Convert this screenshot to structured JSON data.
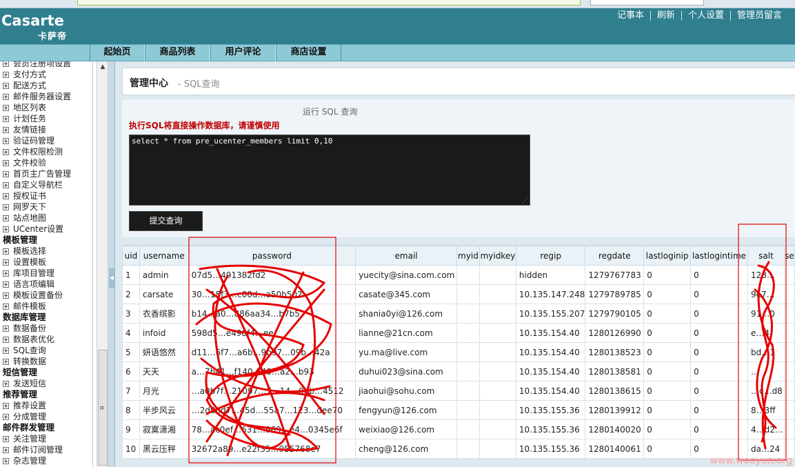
{
  "header": {
    "logo_main": "Casarte",
    "logo_sub": "卡萨帝",
    "links": [
      "记事本",
      "刷新",
      "个人设置",
      "管理员留言"
    ]
  },
  "nav": {
    "tabs": [
      "起始页",
      "商品列表",
      "用户评论",
      "商店设置"
    ]
  },
  "sidebar": {
    "items": [
      {
        "type": "item",
        "label": "会员注册项设置"
      },
      {
        "type": "item",
        "label": "支付方式"
      },
      {
        "type": "item",
        "label": "配送方式"
      },
      {
        "type": "item",
        "label": "邮件服务器设置"
      },
      {
        "type": "item",
        "label": "地区列表"
      },
      {
        "type": "item",
        "label": "计划任务"
      },
      {
        "type": "item",
        "label": "友情链接"
      },
      {
        "type": "item",
        "label": "验证码管理"
      },
      {
        "type": "item",
        "label": "文件权限检测"
      },
      {
        "type": "item",
        "label": "文件校验"
      },
      {
        "type": "item",
        "label": "首页主广告管理"
      },
      {
        "type": "item",
        "label": "自定义导航栏"
      },
      {
        "type": "item",
        "label": "授权证书"
      },
      {
        "type": "item",
        "label": "网罗天下"
      },
      {
        "type": "item",
        "label": "站点地图"
      },
      {
        "type": "item",
        "label": "UCenter设置"
      },
      {
        "type": "head",
        "label": "模板管理"
      },
      {
        "type": "item",
        "label": "模板选择"
      },
      {
        "type": "item",
        "label": "设置模板"
      },
      {
        "type": "item",
        "label": "库项目管理"
      },
      {
        "type": "item",
        "label": "语言项编辑"
      },
      {
        "type": "item",
        "label": "模板设置备份"
      },
      {
        "type": "item",
        "label": "邮件模板"
      },
      {
        "type": "head",
        "label": "数据库管理"
      },
      {
        "type": "item",
        "label": "数据备份"
      },
      {
        "type": "item",
        "label": "数据表优化"
      },
      {
        "type": "item",
        "label": "SQL查询"
      },
      {
        "type": "item",
        "label": "转换数据"
      },
      {
        "type": "head",
        "label": "短信管理"
      },
      {
        "type": "item",
        "label": "发送短信"
      },
      {
        "type": "head",
        "label": "推荐管理"
      },
      {
        "type": "item",
        "label": "推荐设置"
      },
      {
        "type": "item",
        "label": "分成管理"
      },
      {
        "type": "head",
        "label": "邮件群发管理"
      },
      {
        "type": "item",
        "label": "关注管理"
      },
      {
        "type": "item",
        "label": "邮件订阅管理"
      },
      {
        "type": "item",
        "label": "杂志管理"
      }
    ]
  },
  "main": {
    "title": "管理中心",
    "subtitle": "- SQL查询",
    "panel_title": "运行 SQL 查询",
    "warning": "执行SQL将直接操作数据库，请谨慎使用",
    "sql": "select * from pre_ucenter_members limit 0,10",
    "submit": "提交查询"
  },
  "table": {
    "columns": [
      "uid",
      "username",
      "password",
      "email",
      "myid",
      "myidkey",
      "regip",
      "regdate",
      "lastloginip",
      "lastlogintime",
      "salt",
      "se"
    ],
    "rows": [
      [
        "1",
        "admin",
        "07d5…491382fd2",
        "yuecity@sina.com.com",
        "",
        "",
        "hidden",
        "1279767783",
        "0",
        "0",
        "128…",
        ""
      ],
      [
        "2",
        "carsate",
        "30…18f3…c00d…a50b502",
        "casate@345.com",
        "",
        "",
        "10.135.147.248",
        "1279789785",
        "0",
        "0",
        "9e7…",
        ""
      ],
      [
        "3",
        "衣香缤影",
        "b14…a0…886aa34…b7b5",
        "shania0yi@126.com",
        "",
        "",
        "10.135.155.207",
        "1279790105",
        "0",
        "0",
        "91…0",
        ""
      ],
      [
        "4",
        "infoid",
        "598d5…e498f4…ee",
        "lianne@21cn.com",
        "",
        "",
        "10.135.154.40",
        "1280126990",
        "0",
        "0",
        "e…4",
        ""
      ],
      [
        "5",
        "妍语悠然",
        "d11…6f7…a6b…9b97…09b…42a",
        "yu.ma@live.com",
        "",
        "",
        "10.135.154.40",
        "1280138523",
        "0",
        "0",
        "bd…1",
        ""
      ],
      [
        "6",
        "天天",
        "a…7b41…f140…40…a2…b93",
        "duhui023@sina.com",
        "",
        "",
        "10.135.154.40",
        "1280138581",
        "0",
        "0",
        "…",
        ""
      ],
      [
        "7",
        "月光",
        "…a0b7f…21097…7…14…0db…4512",
        "jiaohui@sohu.com",
        "",
        "",
        "10.135.154.40",
        "1280138615",
        "0",
        "0",
        "…c…d8",
        ""
      ],
      [
        "8",
        "半步风云",
        "…2d0bd7…45d…55a7…123…dee70",
        "fengyun@126.com",
        "",
        "",
        "10.135.155.36",
        "1280139912",
        "0",
        "0",
        "8…3ff",
        ""
      ],
      [
        "9",
        "寂寞潇湘",
        "78…ac0ef…631…969…e4…0345e6f",
        "weixiao@126.com",
        "",
        "",
        "10.135.155.36",
        "1280140020",
        "0",
        "0",
        "4…d2…",
        ""
      ],
      [
        "10",
        "黑云压秤",
        "32672a89…e22f35…955768e7",
        "cheng@126.com",
        "",
        "",
        "10.135.155.36",
        "1280140061",
        "0",
        "0",
        "da…24",
        ""
      ]
    ]
  },
  "watermark": "www.wooyun.org",
  "colors": {
    "header": "#2f7f8f",
    "nav": "#8ecad6",
    "warning": "#c00000",
    "scribble": "#e60000"
  }
}
